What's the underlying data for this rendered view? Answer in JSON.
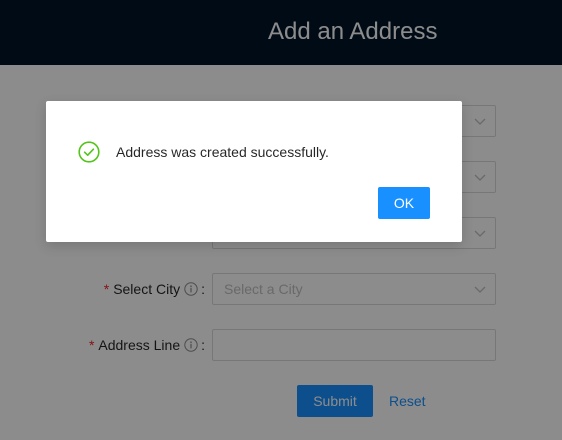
{
  "header": {
    "title": "Add an Address"
  },
  "form": {
    "city": {
      "label": "Select City",
      "placeholder": "Select a City",
      "required": true
    },
    "address": {
      "label": "Address Line",
      "value": "",
      "required": true
    },
    "colon": ":",
    "required_mark": "*",
    "submit_label": "Submit",
    "reset_label": "Reset"
  },
  "modal": {
    "message": "Address was created successfully.",
    "ok_label": "OK",
    "icon": "check-circle-icon"
  },
  "colors": {
    "header_bg": "#001529",
    "primary": "#1890ff",
    "success": "#52c41a",
    "required": "#f5222d"
  }
}
